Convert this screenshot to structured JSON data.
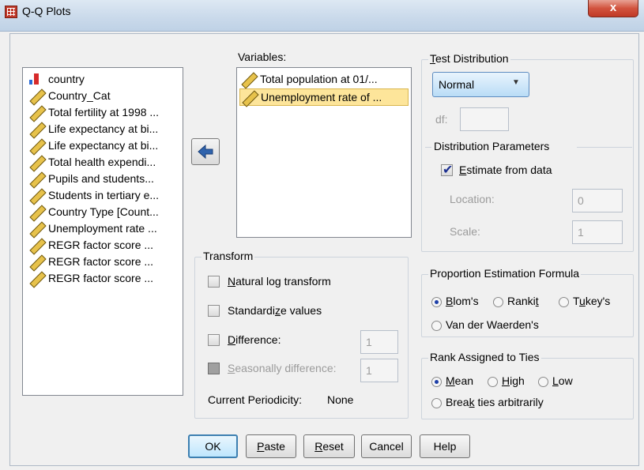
{
  "window": {
    "title": "Q-Q Plots",
    "close_glyph": "x"
  },
  "source_list": {
    "items": [
      {
        "label": "country",
        "icon": "nominal-icon"
      },
      {
        "label": "Country_Cat",
        "icon": "scale-ruler-icon"
      },
      {
        "label": "Total fertility at 1998 ...",
        "icon": "scale-ruler-icon"
      },
      {
        "label": "Life expectancy at bi...",
        "icon": "scale-ruler-icon"
      },
      {
        "label": "Life expectancy at bi...",
        "icon": "scale-ruler-icon"
      },
      {
        "label": "Total health expendi...",
        "icon": "scale-ruler-icon"
      },
      {
        "label": "Pupils and students...",
        "icon": "scale-ruler-icon"
      },
      {
        "label": "Students in tertiary e...",
        "icon": "scale-ruler-icon"
      },
      {
        "label": "Country Type [Count...",
        "icon": "scale-ruler-icon"
      },
      {
        "label": "Unemployment rate ...",
        "icon": "scale-ruler-icon"
      },
      {
        "label": "REGR factor score  ...",
        "icon": "scale-ruler-icon"
      },
      {
        "label": "REGR factor score  ...",
        "icon": "scale-ruler-icon"
      },
      {
        "label": "REGR factor score  ...",
        "icon": "scale-ruler-icon"
      }
    ]
  },
  "variables": {
    "label": "Variables:",
    "items": [
      {
        "label": "Total population at 01/...",
        "selected": false
      },
      {
        "label": "Unemployment rate of ...",
        "selected": true
      }
    ]
  },
  "transform": {
    "legend": "Transform",
    "natural_log": "Natural log transform",
    "standardize": "Standardize values",
    "difference": "Difference:",
    "difference_value": "1",
    "seasonal": "Seasonally difference:",
    "seasonal_value": "1",
    "periodicity_label": "Current Periodicity:",
    "periodicity_value": "None"
  },
  "test_distribution": {
    "legend": "Test Distribution",
    "selected": "Normal",
    "df_label": "df:",
    "params_legend": "Distribution Parameters",
    "estimate_label": "Estimate from data",
    "location_label": "Location:",
    "location_value": "0",
    "scale_label": "Scale:",
    "scale_value": "1"
  },
  "proportion": {
    "legend": "Proportion Estimation Formula",
    "options": [
      "Blom's",
      "Rankit",
      "Tukey's",
      "Van der Waerden's"
    ]
  },
  "rank_ties": {
    "legend": "Rank Assigned to Ties",
    "options": [
      "Mean",
      "High",
      "Low",
      "Break ties arbitrarily"
    ]
  },
  "buttons": {
    "ok": "OK",
    "paste": "Paste",
    "reset": "Reset",
    "cancel": "Cancel",
    "help": "Help"
  }
}
